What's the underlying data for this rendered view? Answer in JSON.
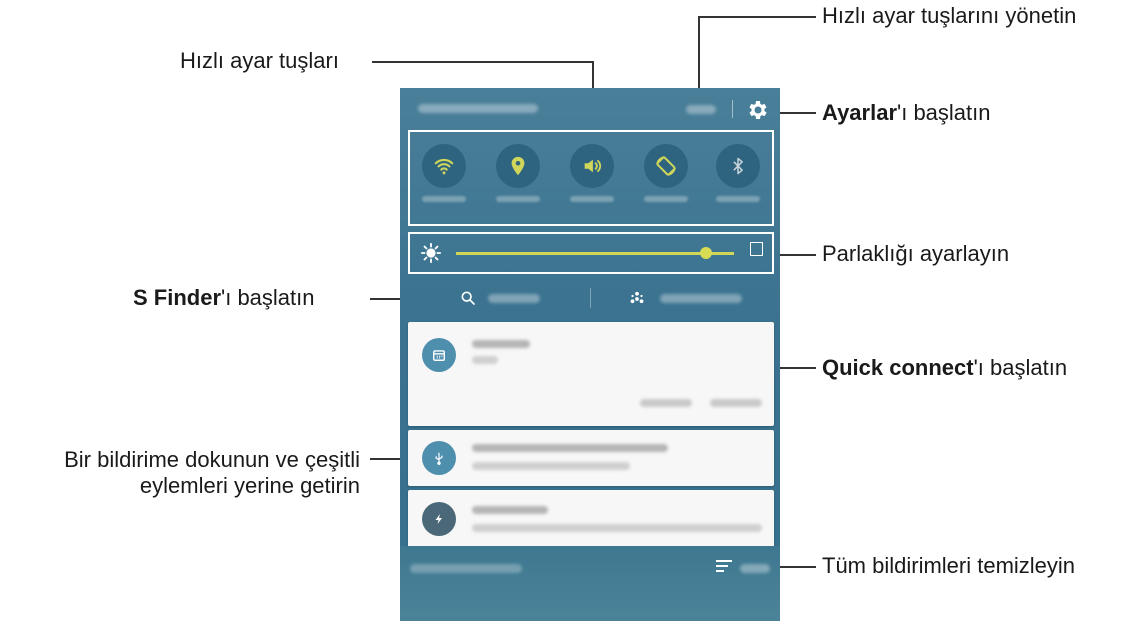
{
  "callouts": {
    "manage_quick_settings": "Hızlı ayar tuşlarını yönetin",
    "quick_settings": "Hızlı ayar tuşları",
    "settings_bold": "Ayarlar",
    "settings_rest": "'ı başlatın",
    "brightness": "Parlaklığı ayarlayın",
    "sfinder_bold": "S Finder",
    "sfinder_rest": "'ı başlatın",
    "quick_connect_bold": "Quick connect",
    "quick_connect_rest": "'ı başlatın",
    "notification_line1": "Bir bildirime dokunun ve çeşitli",
    "notification_line2": "eylemleri yerine getirin",
    "clear_all": "Tüm bildirimleri temizleyin"
  },
  "quick_settings_icons": [
    "wifi-icon",
    "location-icon",
    "sound-icon",
    "rotate-icon",
    "bluetooth-icon"
  ],
  "brightness_level": 0.9,
  "notification_icons": [
    "calendar-icon",
    "usb-icon",
    "charging-icon"
  ],
  "colors": {
    "panel": "#3b7390",
    "icon_circle": "#2f6480",
    "accent": "#cfd65a",
    "card": "#f7f7f7",
    "card_icon": "#4f8fae"
  }
}
